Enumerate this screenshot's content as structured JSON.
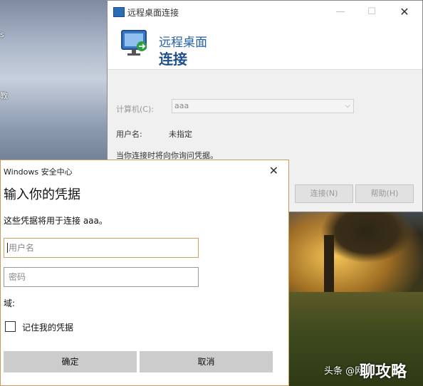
{
  "desktop": {
    "left_text_1": "s",
    "left_text_2": "教",
    "watermark": "头条 @网",
    "watermark_big": "聊攻略"
  },
  "rdp": {
    "window_title": "远程桌面连接",
    "banner_line1": "远程桌面",
    "banner_line2": "连接",
    "computer_label": "计算机(C):",
    "computer_value": "aaa",
    "username_label": "用户名:",
    "username_value": "未指定",
    "info_text": "当你连接时将向你询问凭据。",
    "connect_button": "连接(N)",
    "help_button": "帮助(H)",
    "min_glyph": "—",
    "max_glyph": "☐",
    "close_glyph": "✕",
    "caret_glyph": "⌵"
  },
  "security": {
    "window_title": "Windows 安全中心",
    "close_glyph": "✕",
    "heading": "输入你的凭据",
    "description": "这些凭据将用于连接 aaa。",
    "username_placeholder": "用户名",
    "password_placeholder": "密码",
    "domain_label": "域:",
    "remember_label": "记住我的凭据",
    "remember_checked": false,
    "ok_button": "确定",
    "cancel_button": "取消"
  }
}
